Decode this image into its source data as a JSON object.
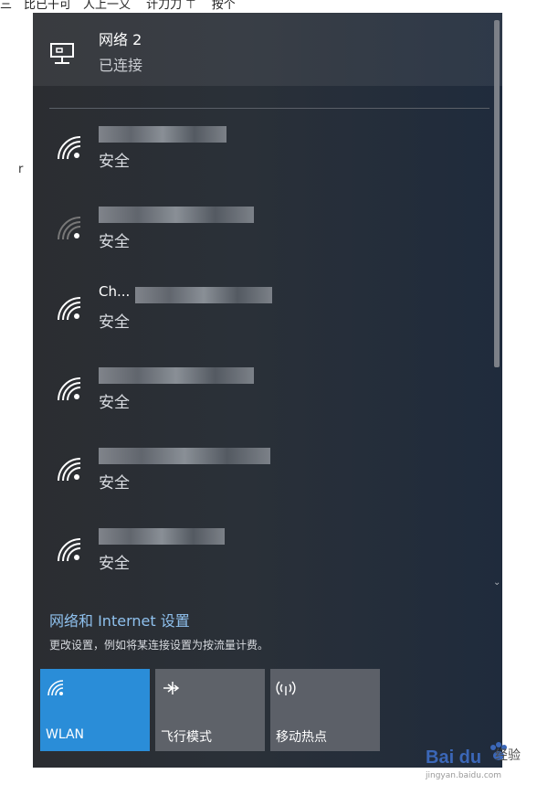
{
  "top_strip": {
    "text": "三　比已干可　人上一又 　计刀刀 ⊤ 　按个　　　　　　　　　　　　　　　　　　　　　　　　　　　　　　　　　　　×"
  },
  "left_edge": {
    "text": "r"
  },
  "connected_network": {
    "name": "网络 2",
    "status": "已连接",
    "icon": "ethernet-icon"
  },
  "wifi_networks": [
    {
      "ssid": "",
      "security": "安全",
      "signal": "full"
    },
    {
      "ssid": "",
      "security": "安全",
      "signal": "weak"
    },
    {
      "ssid": "Ch...",
      "security": "安全",
      "signal": "full"
    },
    {
      "ssid": "",
      "security": "安全",
      "signal": "full"
    },
    {
      "ssid": "",
      "security": "安全",
      "signal": "full"
    },
    {
      "ssid": "",
      "security": "安全",
      "signal": "full"
    }
  ],
  "settings": {
    "link": "网络和 Internet 设置",
    "description": "更改设置，例如将某连接设置为按流量计费。"
  },
  "quick_actions": [
    {
      "label": "WLAN",
      "icon": "wifi-icon",
      "active": true,
      "color": "#2a8dd8"
    },
    {
      "label": "飞行模式",
      "icon": "airplane-icon",
      "active": false
    },
    {
      "label": "移动热点",
      "icon": "hotspot-icon",
      "active": false
    }
  ],
  "watermark": {
    "brand": "Bai du",
    "jingyan": "经验",
    "url": "jingyan.baidu.com"
  }
}
